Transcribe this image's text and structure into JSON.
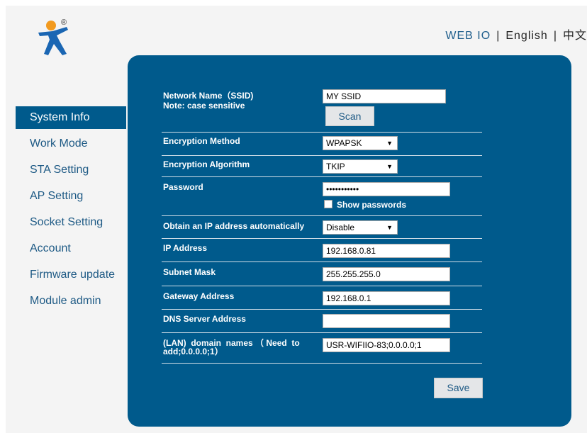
{
  "header": {
    "nav": [
      {
        "label": "WEB IO"
      },
      {
        "label": "English"
      },
      {
        "label": "中文"
      }
    ],
    "separator": "|",
    "logo_icon": "usr-iot-person-logo-icon",
    "logo_mark": "®"
  },
  "sidebar": {
    "items": [
      {
        "label": "System Info",
        "active": true
      },
      {
        "label": "Work Mode"
      },
      {
        "label": "STA Setting"
      },
      {
        "label": "AP Setting"
      },
      {
        "label": "Socket Setting"
      },
      {
        "label": "Account"
      },
      {
        "label": "Firmware update"
      },
      {
        "label": "Module admin"
      }
    ]
  },
  "form": {
    "ssid": {
      "label": "Network Name（SSID)",
      "note": "Note: case sensitive",
      "value": "MY SSID",
      "scan_label": "Scan"
    },
    "encryption_method": {
      "label": "Encryption Method",
      "value": "WPAPSK"
    },
    "encryption_algorithm": {
      "label": "Encryption Algorithm",
      "value": "TKIP"
    },
    "password": {
      "label": "Password",
      "value": "•••••••••••",
      "show_label": "Show passwords"
    },
    "dhcp": {
      "label": "Obtain an IP address automatically",
      "value": "Disable"
    },
    "ip": {
      "label": "IP Address",
      "value": "192.168.0.81"
    },
    "subnet": {
      "label": "Subnet Mask",
      "value": "255.255.255.0"
    },
    "gateway": {
      "label": "Gateway Address",
      "value": "192.168.0.1"
    },
    "dns": {
      "label": "DNS Server Address",
      "value": ""
    },
    "domain": {
      "label_line1": "(LAN)  domain  names （ Need  to",
      "label_line2": "add;0.0.0.0;1）",
      "value": "USR-WIFIIO-83;0.0.0.0;1"
    },
    "save_label": "Save"
  },
  "colors": {
    "panel": "#005a8c",
    "sidebar_active": "#005a8c",
    "logo_orange": "#f29a1f",
    "logo_blue": "#1a66b3"
  }
}
